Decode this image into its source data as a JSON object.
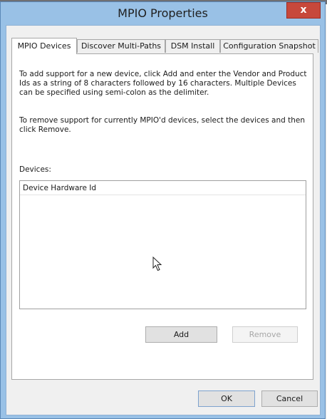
{
  "window": {
    "title": "MPIO Properties",
    "close_glyph": "x"
  },
  "tabs": [
    {
      "label": "MPIO Devices",
      "selected": true
    },
    {
      "label": "Discover Multi-Paths",
      "selected": false
    },
    {
      "label": "DSM Install",
      "selected": false
    },
    {
      "label": "Configuration Snapshot",
      "selected": false
    }
  ],
  "panel": {
    "para_add": "To add support for a new device, click Add and enter the Vendor and Product Ids as a string of 8 characters followed by 16 characters. Multiple Devices can be specified using semi-colon as the delimiter.",
    "para_remove": "To remove support for currently MPIO'd devices, select the devices and then click Remove.",
    "devices_label": "Devices:",
    "list_header": "Device Hardware Id",
    "add_label": "Add",
    "remove_label": "Remove"
  },
  "footer": {
    "ok_label": "OK",
    "cancel_label": "Cancel"
  },
  "colors": {
    "frame": "#99c1e6",
    "close": "#c7483b"
  },
  "icons": [
    "close-icon",
    "mouse-cursor-icon"
  ]
}
